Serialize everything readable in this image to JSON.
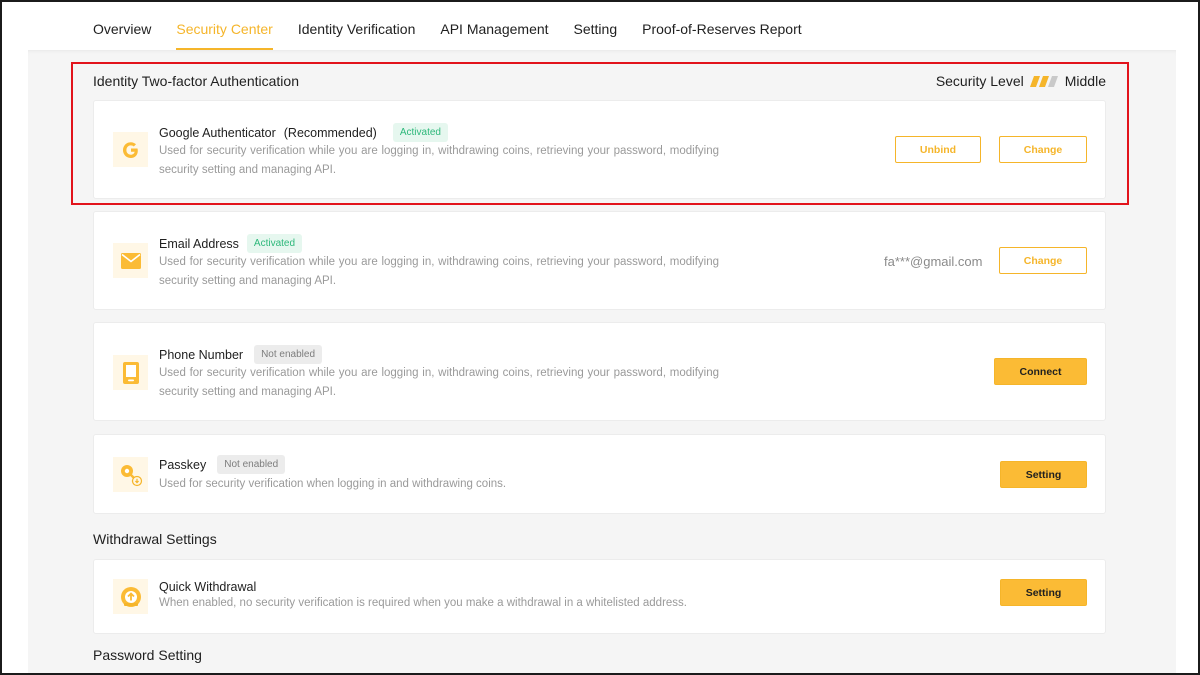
{
  "tabs": [
    {
      "label": "Overview"
    },
    {
      "label": "Security Center",
      "active": true
    },
    {
      "label": "Identity Verification"
    },
    {
      "label": "API Management"
    },
    {
      "label": "Setting"
    },
    {
      "label": "Proof-of-Reserves Report"
    }
  ],
  "two_factor": {
    "title": "Identity Two-factor Authentication",
    "security_level_label": "Security Level",
    "security_level_value": "Middle",
    "security_level_filled": 2,
    "security_level_total": 3
  },
  "google_auth": {
    "name": "Google Authenticator",
    "tag": "(Recommended)",
    "status": "Activated",
    "description": "Used for security verification while you are logging in, withdrawing coins, retrieving your password, modifying security setting and managing API.",
    "unbind_label": "Unbind",
    "change_label": "Change",
    "icon": "google-icon"
  },
  "email": {
    "name": "Email Address",
    "status": "Activated",
    "description": "Used for security verification while you are logging in, withdrawing coins, retrieving your password, modifying security setting and managing API.",
    "value": "fa***@gmail.com",
    "change_label": "Change",
    "icon": "envelope-icon"
  },
  "phone": {
    "name": "Phone Number",
    "status": "Not enabled",
    "description": "Used for security verification while you are logging in, withdrawing coins, retrieving your password, modifying security setting and managing API.",
    "connect_label": "Connect",
    "icon": "phone-icon"
  },
  "passkey": {
    "name": "Passkey",
    "status": "Not enabled",
    "description": "Used for security verification when logging in and withdrawing coins.",
    "setting_label": "Setting",
    "icon": "key-icon"
  },
  "withdrawal": {
    "title": "Withdrawal Settings",
    "quick": {
      "name": "Quick Withdrawal",
      "description": "When enabled, no security verification is required when you make a withdrawal in a whitelisted address.",
      "setting_label": "Setting",
      "icon": "quick-withdrawal-icon"
    }
  },
  "password": {
    "title": "Password Setting"
  },
  "colors": {
    "accent": "#f5b52a",
    "activated": "#2eb87b",
    "highlight": "#e2141c"
  }
}
